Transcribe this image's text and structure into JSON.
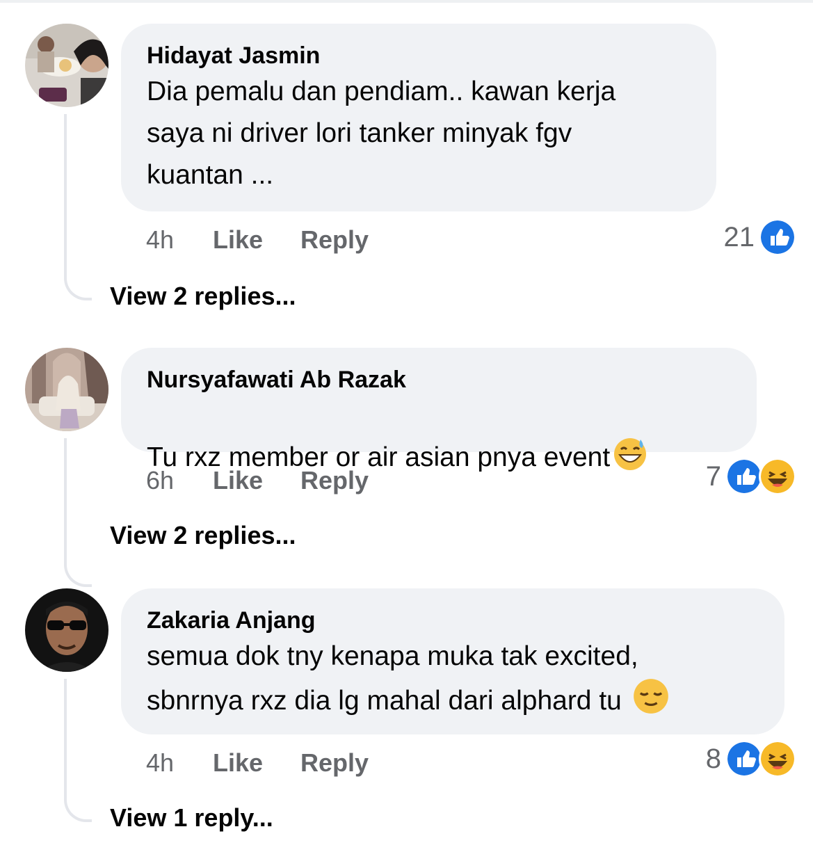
{
  "colors": {
    "bubble": "#f0f2f5",
    "meta_text": "#65676b",
    "like_blue": "#1b74e4",
    "haha_yellow": "#f7b928"
  },
  "comments": [
    {
      "author": "Hidayat Jasmin",
      "text": "Dia pemalu dan pendiam.. kawan kerja\nsaya ni driver lori tanker minyak fgv\nkuantan ...",
      "time": "4h",
      "like_label": "Like",
      "reply_label": "Reply",
      "reaction_count": "21",
      "reactions": [
        "like-icon"
      ],
      "view_replies": "View 2 replies..."
    },
    {
      "author": "Nursyafawati Ab Razak",
      "text": "Tu rxz member or air asian pnya event",
      "inline_emoji": "grinning-sweat-emoji",
      "time": "6h",
      "like_label": "Like",
      "reply_label": "Reply",
      "reaction_count": "7",
      "reactions": [
        "like-icon",
        "haha-icon"
      ],
      "view_replies": "View 2 replies..."
    },
    {
      "author": "Zakaria Anjang",
      "text": "semua dok tny kenapa muka tak excited,\nsbnrnya rxz dia lg mahal dari alphard tu ",
      "inline_emoji": "relieved-face-emoji",
      "time": "4h",
      "like_label": "Like",
      "reply_label": "Reply",
      "reaction_count": "8",
      "reactions": [
        "like-icon",
        "haha-icon"
      ],
      "view_replies": "View 1 reply..."
    }
  ]
}
